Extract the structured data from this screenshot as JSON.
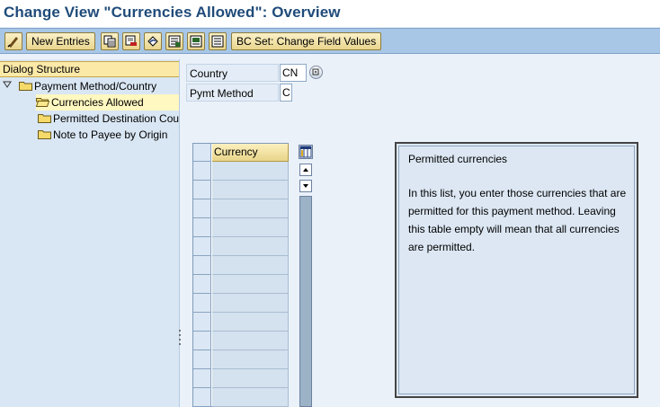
{
  "window": {
    "title": "Change View \"Currencies Allowed\": Overview"
  },
  "toolbar": {
    "new_entries_label": "New Entries",
    "bc_set_label": "BC Set: Change Field Values",
    "icons": [
      "display-change-icon",
      "copy-icon",
      "delete-icon",
      "undo-icon",
      "select-all-icon",
      "select-block-icon",
      "deselect-all-icon"
    ]
  },
  "dialog_structure": {
    "header": "Dialog Structure",
    "items": [
      {
        "label": "Payment Method/Country",
        "selected": false,
        "expanded": true
      },
      {
        "label": "Currencies Allowed",
        "selected": true,
        "open_folder": true
      },
      {
        "label": "Permitted Destination Cou",
        "selected": false
      },
      {
        "label": "Note to Payee by Origin",
        "selected": false
      }
    ]
  },
  "fields": {
    "country_label": "Country",
    "country_value": "CN",
    "payment_method_label": "Pymt Method",
    "payment_method_value": "C"
  },
  "table": {
    "columns": [
      "Currency"
    ],
    "rows": [
      "",
      "",
      "",
      "",
      "",
      "",
      "",
      "",
      "",
      "",
      "",
      "",
      ""
    ]
  },
  "help": {
    "title": "Permitted currencies",
    "body": "In this list, you enter those currencies that are permitted for this payment method. Leaving this table empty will mean that all currencies are permitted."
  },
  "colors": {
    "title_text": "#1f4b7a",
    "toolbar_bg": "#a8c6e6",
    "button_bg": "#f1e1a4",
    "selected_row": "#fff8c0",
    "panel_bg": "#eaf1f9"
  }
}
